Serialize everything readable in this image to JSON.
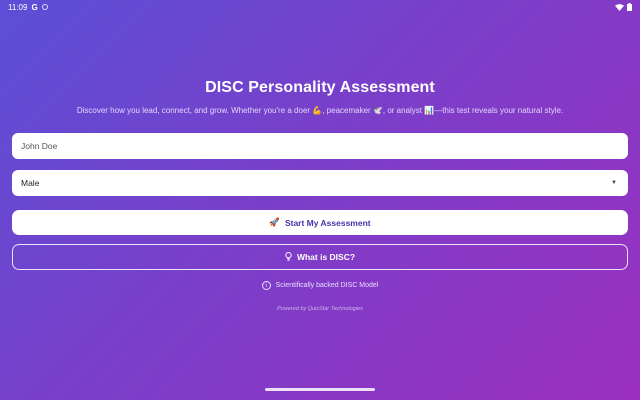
{
  "status_bar": {
    "time": "11:09",
    "g_label": "G"
  },
  "header": {
    "title": "DISC Personality Assessment",
    "subtitle": "Discover how you lead, connect, and grow. Whether you're a doer 💪, peacemaker 🕊️, or analyst 📊—this test reveals your natural style."
  },
  "form": {
    "name_value": "John Doe",
    "gender_value": "Male"
  },
  "actions": {
    "start_icon": "🚀",
    "start_label": "Start My Assessment",
    "what_icon": "💡",
    "what_label": "What is DISC?"
  },
  "footer": {
    "info_text": "Scientifically backed DISC Model",
    "powered_by": "Powered by QuizStar Technologies"
  },
  "colors": {
    "gradient_start": "#5b4fd6",
    "gradient_end": "#9b2fbf",
    "primary_text": "#4b2fa8"
  }
}
